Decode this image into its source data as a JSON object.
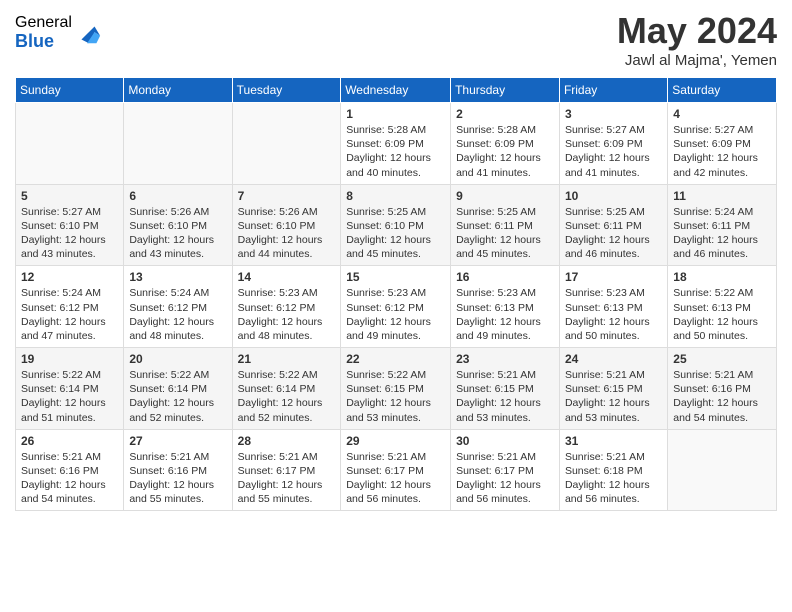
{
  "header": {
    "logo_general": "General",
    "logo_blue": "Blue",
    "month_title": "May 2024",
    "location": "Jawl al Majma', Yemen"
  },
  "days_of_week": [
    "Sunday",
    "Monday",
    "Tuesday",
    "Wednesday",
    "Thursday",
    "Friday",
    "Saturday"
  ],
  "weeks": [
    [
      {
        "day": "",
        "sunrise": "",
        "sunset": "",
        "daylight": ""
      },
      {
        "day": "",
        "sunrise": "",
        "sunset": "",
        "daylight": ""
      },
      {
        "day": "",
        "sunrise": "",
        "sunset": "",
        "daylight": ""
      },
      {
        "day": "1",
        "sunrise": "Sunrise: 5:28 AM",
        "sunset": "Sunset: 6:09 PM",
        "daylight": "Daylight: 12 hours and 40 minutes."
      },
      {
        "day": "2",
        "sunrise": "Sunrise: 5:28 AM",
        "sunset": "Sunset: 6:09 PM",
        "daylight": "Daylight: 12 hours and 41 minutes."
      },
      {
        "day": "3",
        "sunrise": "Sunrise: 5:27 AM",
        "sunset": "Sunset: 6:09 PM",
        "daylight": "Daylight: 12 hours and 41 minutes."
      },
      {
        "day": "4",
        "sunrise": "Sunrise: 5:27 AM",
        "sunset": "Sunset: 6:09 PM",
        "daylight": "Daylight: 12 hours and 42 minutes."
      }
    ],
    [
      {
        "day": "5",
        "sunrise": "Sunrise: 5:27 AM",
        "sunset": "Sunset: 6:10 PM",
        "daylight": "Daylight: 12 hours and 43 minutes."
      },
      {
        "day": "6",
        "sunrise": "Sunrise: 5:26 AM",
        "sunset": "Sunset: 6:10 PM",
        "daylight": "Daylight: 12 hours and 43 minutes."
      },
      {
        "day": "7",
        "sunrise": "Sunrise: 5:26 AM",
        "sunset": "Sunset: 6:10 PM",
        "daylight": "Daylight: 12 hours and 44 minutes."
      },
      {
        "day": "8",
        "sunrise": "Sunrise: 5:25 AM",
        "sunset": "Sunset: 6:10 PM",
        "daylight": "Daylight: 12 hours and 45 minutes."
      },
      {
        "day": "9",
        "sunrise": "Sunrise: 5:25 AM",
        "sunset": "Sunset: 6:11 PM",
        "daylight": "Daylight: 12 hours and 45 minutes."
      },
      {
        "day": "10",
        "sunrise": "Sunrise: 5:25 AM",
        "sunset": "Sunset: 6:11 PM",
        "daylight": "Daylight: 12 hours and 46 minutes."
      },
      {
        "day": "11",
        "sunrise": "Sunrise: 5:24 AM",
        "sunset": "Sunset: 6:11 PM",
        "daylight": "Daylight: 12 hours and 46 minutes."
      }
    ],
    [
      {
        "day": "12",
        "sunrise": "Sunrise: 5:24 AM",
        "sunset": "Sunset: 6:12 PM",
        "daylight": "Daylight: 12 hours and 47 minutes."
      },
      {
        "day": "13",
        "sunrise": "Sunrise: 5:24 AM",
        "sunset": "Sunset: 6:12 PM",
        "daylight": "Daylight: 12 hours and 48 minutes."
      },
      {
        "day": "14",
        "sunrise": "Sunrise: 5:23 AM",
        "sunset": "Sunset: 6:12 PM",
        "daylight": "Daylight: 12 hours and 48 minutes."
      },
      {
        "day": "15",
        "sunrise": "Sunrise: 5:23 AM",
        "sunset": "Sunset: 6:12 PM",
        "daylight": "Daylight: 12 hours and 49 minutes."
      },
      {
        "day": "16",
        "sunrise": "Sunrise: 5:23 AM",
        "sunset": "Sunset: 6:13 PM",
        "daylight": "Daylight: 12 hours and 49 minutes."
      },
      {
        "day": "17",
        "sunrise": "Sunrise: 5:23 AM",
        "sunset": "Sunset: 6:13 PM",
        "daylight": "Daylight: 12 hours and 50 minutes."
      },
      {
        "day": "18",
        "sunrise": "Sunrise: 5:22 AM",
        "sunset": "Sunset: 6:13 PM",
        "daylight": "Daylight: 12 hours and 50 minutes."
      }
    ],
    [
      {
        "day": "19",
        "sunrise": "Sunrise: 5:22 AM",
        "sunset": "Sunset: 6:14 PM",
        "daylight": "Daylight: 12 hours and 51 minutes."
      },
      {
        "day": "20",
        "sunrise": "Sunrise: 5:22 AM",
        "sunset": "Sunset: 6:14 PM",
        "daylight": "Daylight: 12 hours and 52 minutes."
      },
      {
        "day": "21",
        "sunrise": "Sunrise: 5:22 AM",
        "sunset": "Sunset: 6:14 PM",
        "daylight": "Daylight: 12 hours and 52 minutes."
      },
      {
        "day": "22",
        "sunrise": "Sunrise: 5:22 AM",
        "sunset": "Sunset: 6:15 PM",
        "daylight": "Daylight: 12 hours and 53 minutes."
      },
      {
        "day": "23",
        "sunrise": "Sunrise: 5:21 AM",
        "sunset": "Sunset: 6:15 PM",
        "daylight": "Daylight: 12 hours and 53 minutes."
      },
      {
        "day": "24",
        "sunrise": "Sunrise: 5:21 AM",
        "sunset": "Sunset: 6:15 PM",
        "daylight": "Daylight: 12 hours and 53 minutes."
      },
      {
        "day": "25",
        "sunrise": "Sunrise: 5:21 AM",
        "sunset": "Sunset: 6:16 PM",
        "daylight": "Daylight: 12 hours and 54 minutes."
      }
    ],
    [
      {
        "day": "26",
        "sunrise": "Sunrise: 5:21 AM",
        "sunset": "Sunset: 6:16 PM",
        "daylight": "Daylight: 12 hours and 54 minutes."
      },
      {
        "day": "27",
        "sunrise": "Sunrise: 5:21 AM",
        "sunset": "Sunset: 6:16 PM",
        "daylight": "Daylight: 12 hours and 55 minutes."
      },
      {
        "day": "28",
        "sunrise": "Sunrise: 5:21 AM",
        "sunset": "Sunset: 6:17 PM",
        "daylight": "Daylight: 12 hours and 55 minutes."
      },
      {
        "day": "29",
        "sunrise": "Sunrise: 5:21 AM",
        "sunset": "Sunset: 6:17 PM",
        "daylight": "Daylight: 12 hours and 56 minutes."
      },
      {
        "day": "30",
        "sunrise": "Sunrise: 5:21 AM",
        "sunset": "Sunset: 6:17 PM",
        "daylight": "Daylight: 12 hours and 56 minutes."
      },
      {
        "day": "31",
        "sunrise": "Sunrise: 5:21 AM",
        "sunset": "Sunset: 6:18 PM",
        "daylight": "Daylight: 12 hours and 56 minutes."
      },
      {
        "day": "",
        "sunrise": "",
        "sunset": "",
        "daylight": ""
      }
    ]
  ]
}
